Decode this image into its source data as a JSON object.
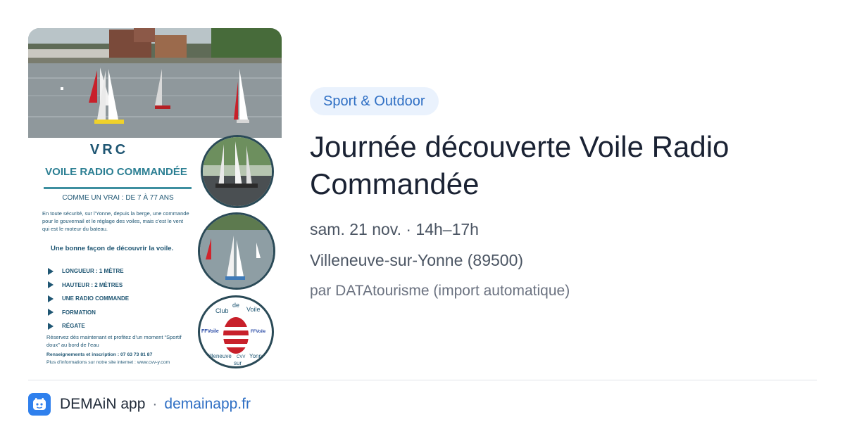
{
  "poster": {
    "heading": "VRC",
    "subheading": "VOILE RADIO COMMANDÉE",
    "tagline": "COMME UN VRAI : DE 7 À 77 ANS",
    "intro": "En toute sécurité, sur l’Yonne, depuis la berge, une commande pour le gouvernail et le réglage des voiles, mais c’est le vent qui est le moteur du bateau.",
    "highlight": "Une bonne façon de découvrir la voile.",
    "features": [
      "LONGUEUR : 1 MÈTRE",
      "HAUTEUR : 2 MÈTRES",
      "UNE RADIO COMMANDE",
      "FORMATION",
      "RÉGATE"
    ],
    "reserve": "Réservez dès maintenant et profitez d’un moment “Sportif doux” au bord de l’eau",
    "contact": "Renseignements et inscription : 07 63 73 81 87",
    "website": "Plus d’informations sur notre site internet : www.cvv-y.com",
    "club_logo_text": [
      "Club",
      "de",
      "Voile",
      "Villeneuve",
      "sur",
      "Yonne",
      "FFVoile",
      "CVV"
    ]
  },
  "category_badge": "Sport & Outdoor",
  "event_title": "Journée découverte Voile Radio Commandée",
  "event_date": "sam. 21 nov. · 14h–17h",
  "event_location": "Villeneuve-sur-Yonne (89500)",
  "event_source": "par DATAtourisme (import automatique)",
  "footer": {
    "app_name": "DEMAiN app",
    "separator": "·",
    "domain": "demainapp.fr"
  },
  "colors": {
    "badge_bg": "#eaf2fd",
    "accent": "#2f6fc4",
    "title": "#1a2233",
    "poster_blue": "#1f5673",
    "logo_bg": "#2f80ed"
  },
  "icons": [
    "play-bullet-icon",
    "demain-logo-icon"
  ]
}
